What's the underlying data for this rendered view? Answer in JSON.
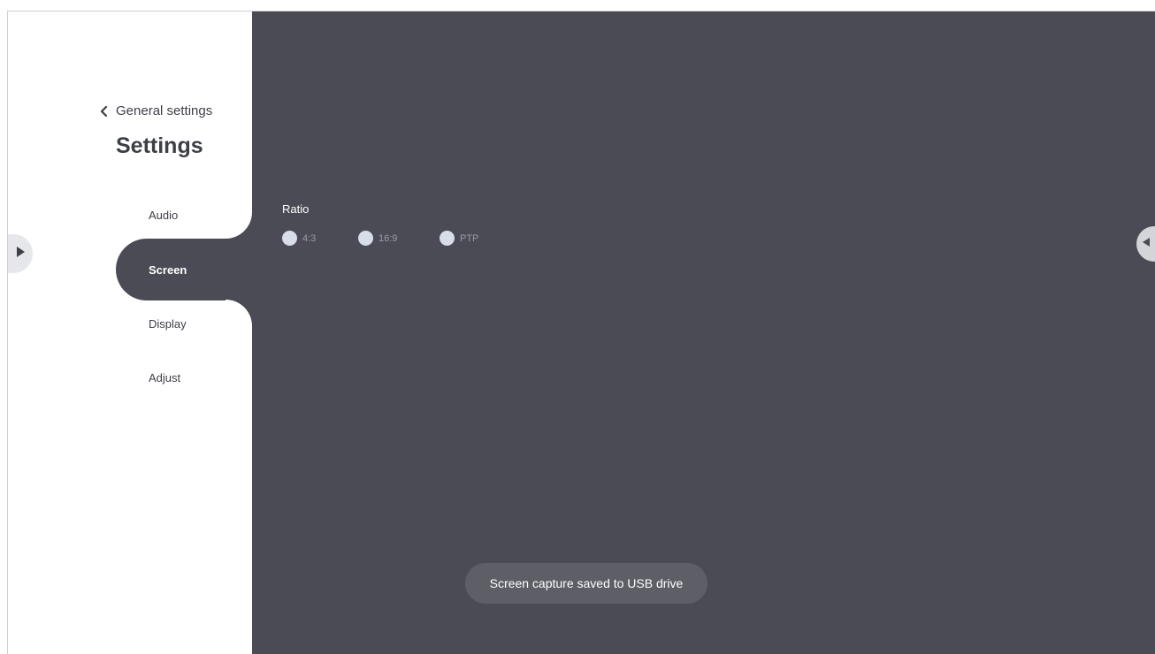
{
  "header": {
    "back_label": "General settings",
    "title": "Settings"
  },
  "sidebar": {
    "items": [
      {
        "label": "Audio"
      },
      {
        "label": "Screen"
      },
      {
        "label": "Display"
      },
      {
        "label": "Adjust"
      }
    ],
    "active": "Screen"
  },
  "main": {
    "ratio_label": "Ratio",
    "ratio_options": [
      {
        "label": "4:3"
      },
      {
        "label": "16:9"
      },
      {
        "label": "PTP"
      }
    ]
  },
  "toast": {
    "message": "Screen capture saved to USB drive"
  },
  "icons": {
    "back": "chevron-left-icon",
    "expand_left": "play-right-icon",
    "expand_right": "play-left-icon"
  },
  "colors": {
    "panel": "#4a4b54",
    "sidebar": "#ffffff",
    "text_dark": "#3d3f47",
    "radio": "#d8dde8",
    "toast": "#5e5f66"
  }
}
